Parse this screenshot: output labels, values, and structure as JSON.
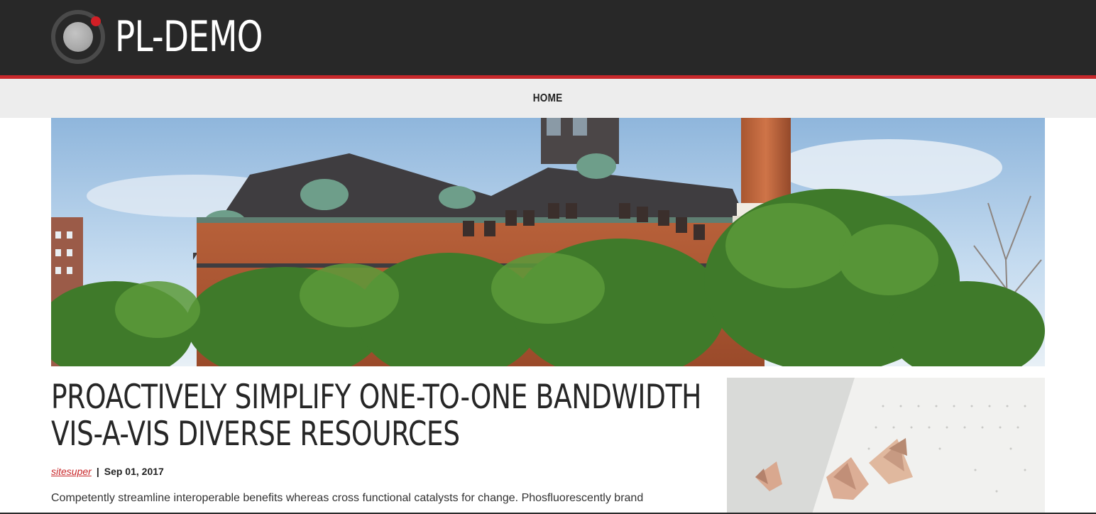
{
  "header": {
    "site_title": "PL-DEMO",
    "accent_color": "#c8282b",
    "background_color": "#282828"
  },
  "nav": {
    "items": [
      {
        "label": "HOME"
      }
    ]
  },
  "hero": {
    "image_icon": "building-photo"
  },
  "article": {
    "title": "PROACTIVELY SIMPLIFY ONE-TO-ONE BANDWIDTH VIS-A-VIS DIVERSE RESOURCES",
    "author": "sitesuper",
    "separator": "|",
    "date": "Sep 01, 2017",
    "excerpt": "Competently streamline interoperable benefits whereas cross functional catalysts for change. Phosfluorescently brand"
  },
  "sidebar": {
    "image_icon": "pencil-shavings-photo"
  }
}
